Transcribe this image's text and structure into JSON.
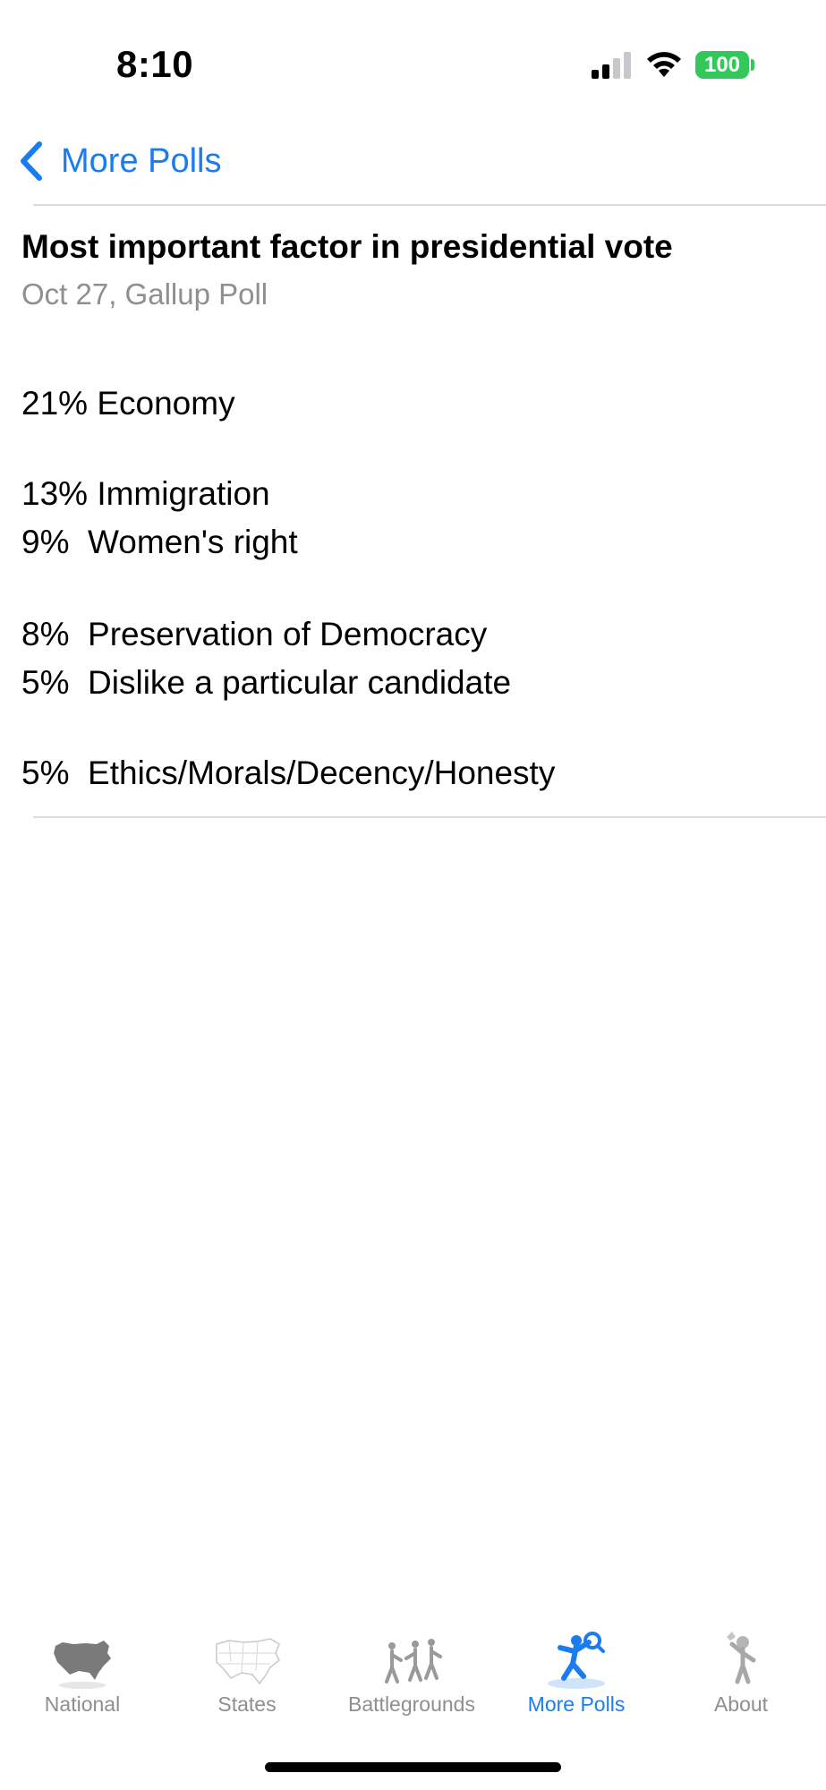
{
  "status_bar": {
    "time": "8:10",
    "battery": "100",
    "icons": [
      "signal-icon",
      "wifi-icon",
      "battery-icon"
    ],
    "battery_color": "#34c759"
  },
  "nav": {
    "back_label": "More Polls",
    "back_icon": "chevron-left-icon",
    "accent_color": "#1a7cf0"
  },
  "poll": {
    "title": "Most important factor in presidential vote",
    "subtitle": "Oct 27, Gallup Poll",
    "items": [
      {
        "text": "21% Economy"
      },
      {
        "text": "13% Immigration"
      },
      {
        "text": "9%  Women's right"
      },
      {
        "text": "8%  Preservation of Democracy"
      },
      {
        "text": "5%  Dislike a particular candidate"
      },
      {
        "text": "5%  Ethics/Morals/Decency/Honesty"
      }
    ]
  },
  "tab_bar": {
    "active_index": 3,
    "tabs": [
      {
        "label": "National",
        "icon": "us-map-icon"
      },
      {
        "label": "States",
        "icon": "states-map-icon"
      },
      {
        "label": "Battlegrounds",
        "icon": "battlegrounds-icon"
      },
      {
        "label": "More Polls",
        "icon": "more-polls-icon"
      },
      {
        "label": "About",
        "icon": "about-icon"
      }
    ]
  }
}
